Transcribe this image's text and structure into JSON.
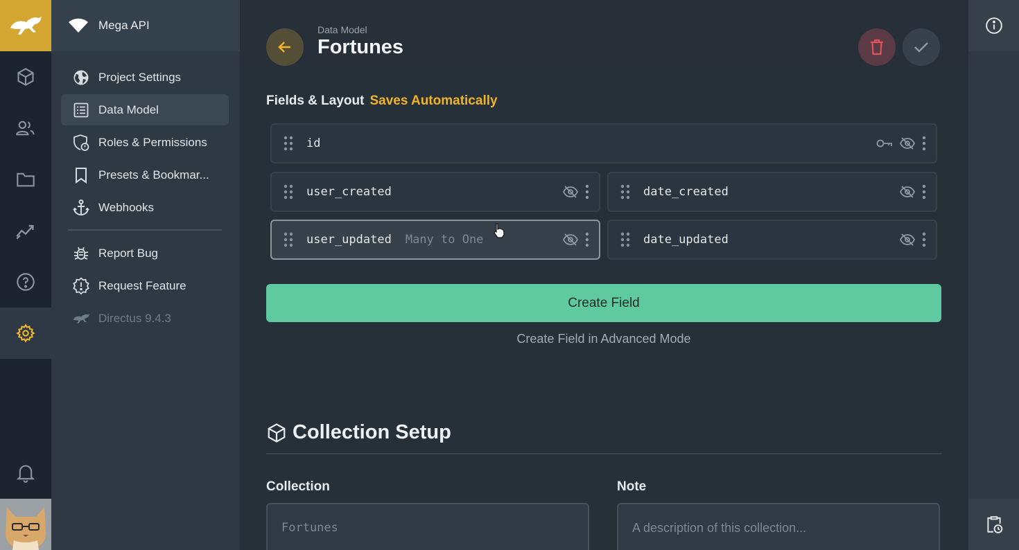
{
  "project": {
    "name": "Mega API"
  },
  "module_bar": {
    "modules": [
      "content-icon",
      "users-icon",
      "files-icon",
      "insights-icon",
      "help-icon",
      "settings-icon"
    ],
    "bottom": [
      "notifications-icon",
      "avatar"
    ]
  },
  "nav": {
    "items": [
      {
        "label": "Project Settings",
        "icon": "globe-icon"
      },
      {
        "label": "Data Model",
        "icon": "list-icon",
        "active": true
      },
      {
        "label": "Roles & Permissions",
        "icon": "badge-icon"
      },
      {
        "label": "Presets & Bookmar...",
        "icon": "bookmark-icon"
      },
      {
        "label": "Webhooks",
        "icon": "anchor-icon"
      }
    ],
    "secondary": [
      {
        "label": "Report Bug",
        "icon": "bug-icon"
      },
      {
        "label": "Request Feature",
        "icon": "feature-icon"
      },
      {
        "label": "Directus 9.4.3",
        "icon": "directus-logo"
      }
    ]
  },
  "header": {
    "breadcrumb": "Data Model",
    "title": "Fortunes"
  },
  "fields_section": {
    "label": "Fields & Layout",
    "autosave": "Saves Automatically"
  },
  "fields": [
    {
      "name": "id",
      "meta": ""
    },
    {
      "name": "user_created",
      "meta": ""
    },
    {
      "name": "date_created",
      "meta": ""
    },
    {
      "name": "user_updated",
      "meta": "Many to One"
    },
    {
      "name": "date_updated",
      "meta": ""
    }
  ],
  "actions": {
    "create_field": "Create Field",
    "create_advanced": "Create Field in Advanced Mode"
  },
  "collection_setup": {
    "title": "Collection Setup",
    "collection_label": "Collection",
    "collection_value": "Fortunes",
    "note_label": "Note",
    "note_placeholder": "A description of this collection..."
  },
  "colors": {
    "accent": "#f0b429",
    "primary_button": "#5fc9a0",
    "danger": "#e0525e"
  }
}
